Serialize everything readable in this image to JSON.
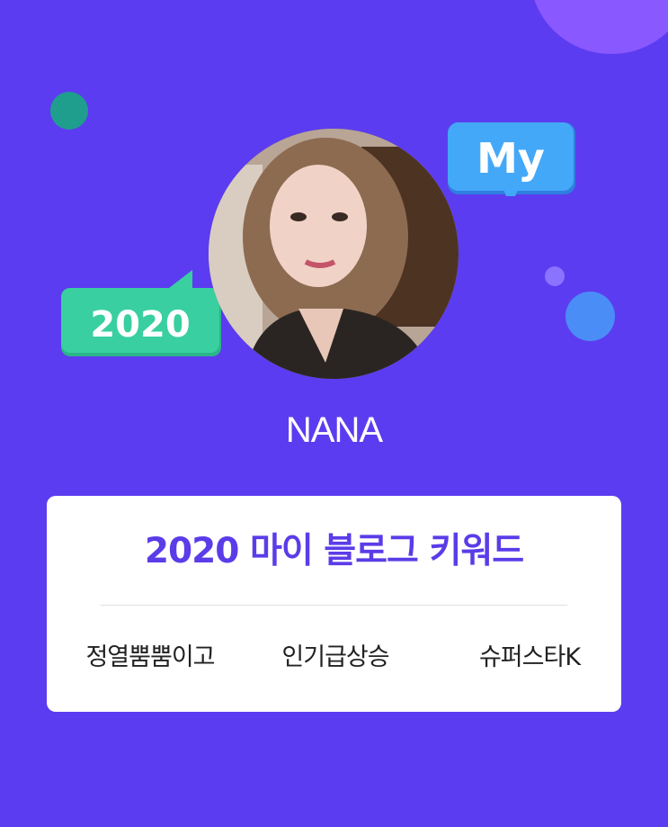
{
  "badges": {
    "my": "My",
    "year": "2020"
  },
  "profile": {
    "name": "NANA"
  },
  "card": {
    "title": "2020 마이 블로그 키워드",
    "keywords": [
      "정열뿜뿜이고",
      "인기급상승",
      "슈퍼스타K"
    ]
  },
  "colors": {
    "background": "#5c3cf0",
    "title": "#5b3ce8",
    "my_bubble": "#44a8f8",
    "year_bubble": "#39cfa0"
  }
}
